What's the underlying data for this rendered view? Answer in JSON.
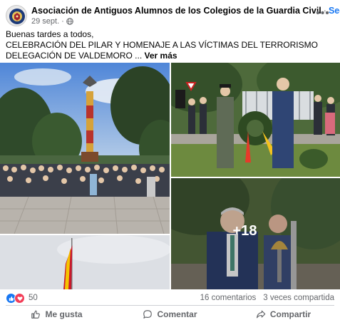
{
  "post": {
    "author": "Asociación de Antiguos Alumnos de los Colegios de la Guardia Civil",
    "separator": "·",
    "follow_label": "Seguir",
    "date": "29 sept.",
    "meta_separator": "·",
    "privacy_icon": "globe-icon",
    "more_icon": "more-horizontal-icon",
    "more_label": "•••",
    "text_line1": "Buenas tardes a todos,",
    "text_line2": "CELEBRACIÓN DEL PILAR Y HOMENAJE A LAS VÍCTIMAS DEL TERRORISMO DELEGACIÓN DE VALDEMORO",
    "ellipsis": " ... ",
    "see_more": "Ver más"
  },
  "photos": {
    "more_count": "+18"
  },
  "reactions": {
    "count": "50",
    "comments": "16 comentarios",
    "shares": "3 veces compartida"
  },
  "actions": {
    "like": "Me gusta",
    "comment": "Comentar",
    "share": "Compartir"
  },
  "colors": {
    "accent": "#1877f2",
    "love": "#f33e58",
    "secondary_text": "#65676b"
  }
}
